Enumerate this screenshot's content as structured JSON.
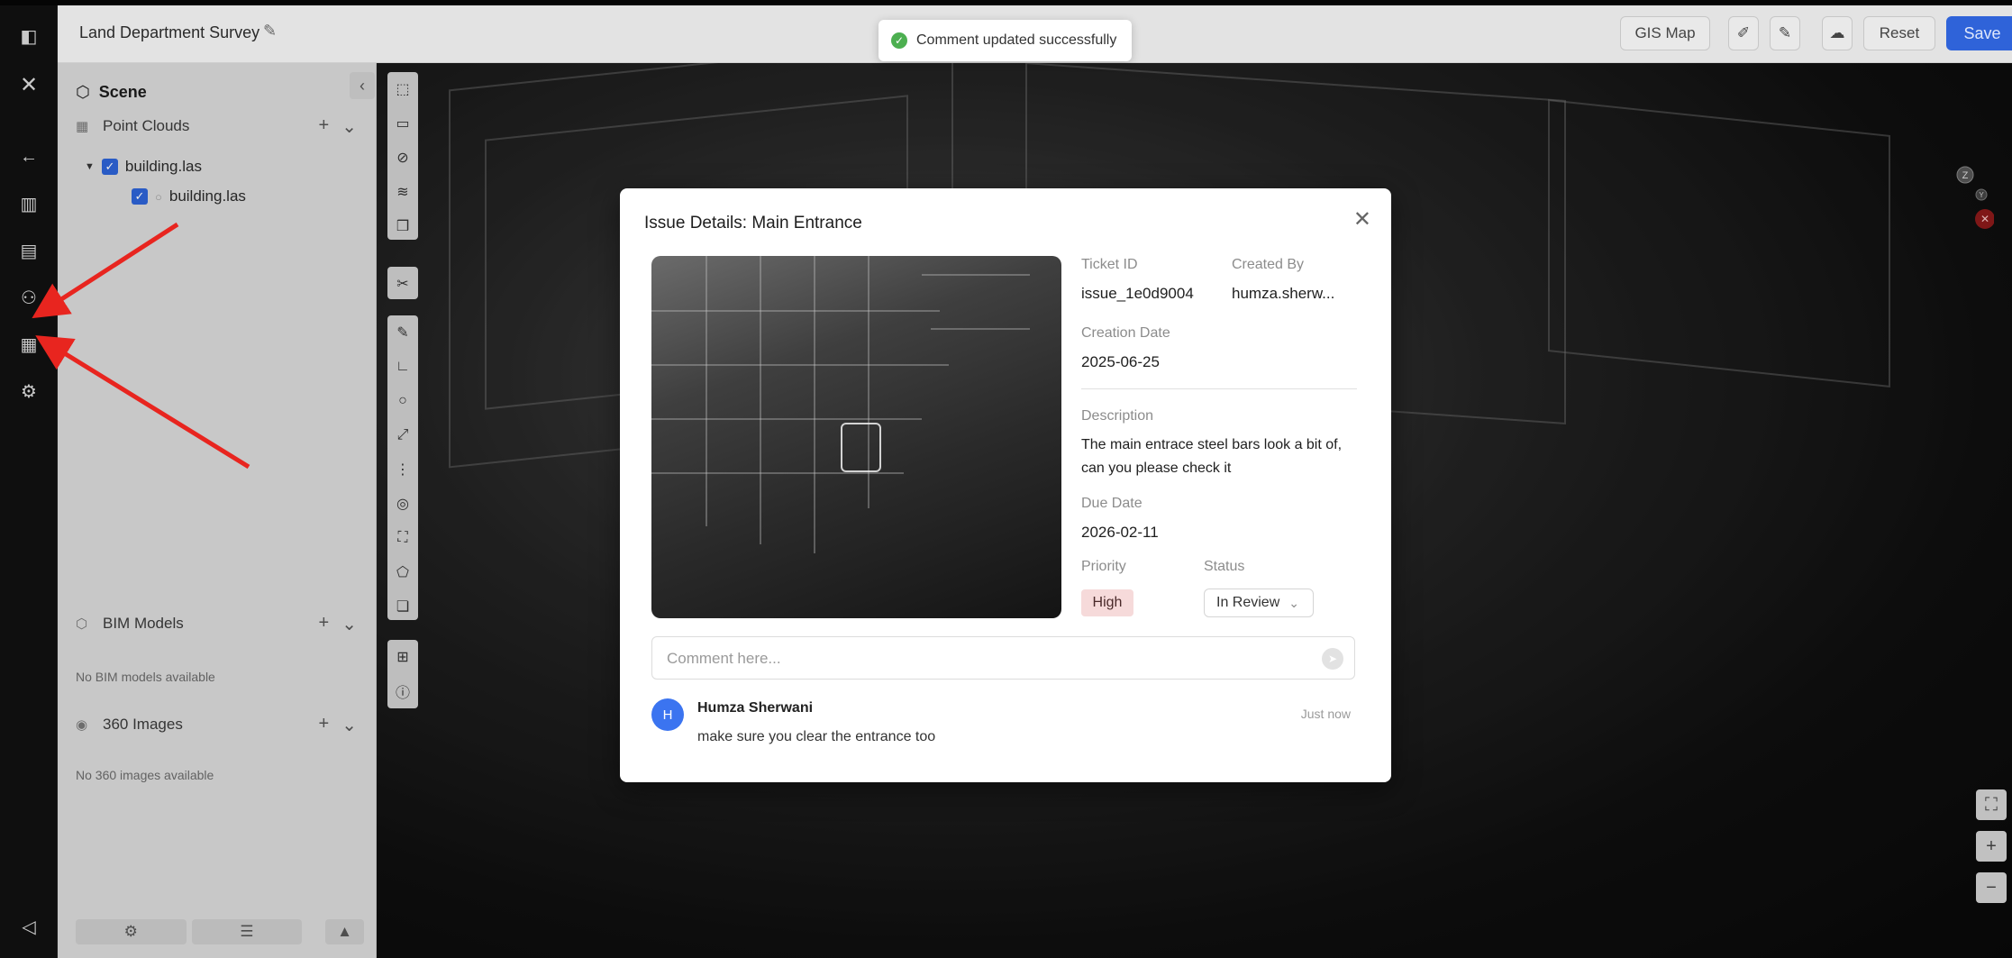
{
  "header": {
    "project_title": "Land Department Survey",
    "gis_map": "GIS Map",
    "reset": "Reset",
    "save": "Save"
  },
  "toast": {
    "message": "Comment updated successfully"
  },
  "scene": {
    "title": "Scene",
    "point_clouds": {
      "label": "Point Clouds",
      "tree": [
        {
          "label": "building.las",
          "checked": true
        },
        {
          "label": "building.las",
          "checked": true
        }
      ]
    },
    "bim_models": {
      "label": "BIM Models",
      "empty": "No BIM models available"
    },
    "images_360": {
      "label": "360 Images",
      "empty": "No 360 images available"
    }
  },
  "modal": {
    "title": "Issue Details: Main Entrance",
    "ticket_id_label": "Ticket ID",
    "ticket_id": "issue_1e0d9004",
    "created_by_label": "Created By",
    "created_by": "humza.sherw...",
    "creation_date_label": "Creation Date",
    "creation_date": "2025-06-25",
    "description_label": "Description",
    "description": "The main entrace steel bars look a bit of, can you please check it",
    "due_date_label": "Due Date",
    "due_date": "2026-02-11",
    "priority_label": "Priority",
    "priority": "High",
    "status_label": "Status",
    "status": "In Review",
    "comment_placeholder": "Comment here...",
    "comments": [
      {
        "initial": "H",
        "author": "Humza Sherwani",
        "time": "Just now",
        "text": "make sure you clear the entrance too"
      }
    ]
  },
  "gizmo": {
    "z": "Z",
    "y": "Y"
  },
  "colors": {
    "accent": "#2f63d9",
    "toast_success": "#4caf50",
    "priority_high_bg": "#f6dada",
    "annotation_arrow": "#e8251f"
  }
}
